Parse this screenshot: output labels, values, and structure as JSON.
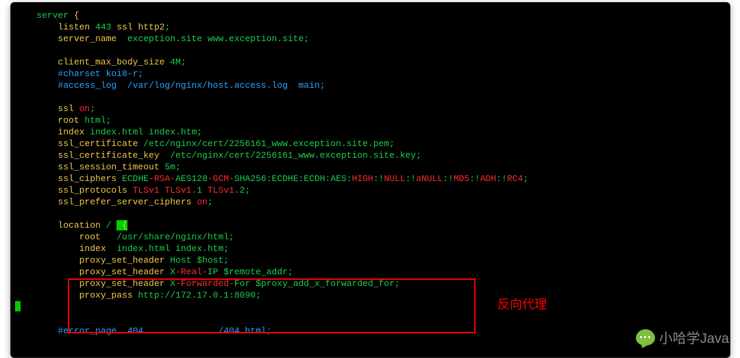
{
  "code": {
    "l1a": "    server ",
    "l1b": "{",
    "l2a": "        listen",
    "l2b": " 443 ",
    "l2c": "ssl http2",
    "l2d": ";",
    "l3a": "        server_name ",
    "l3b": " exception.site www.exception.site;",
    "l5a": "        client_max_body_size",
    "l5b": " 4M;",
    "l6": "        #charset koi8-r;",
    "l7": "        #access_log  /var/log/nginx/host.access.log  main;",
    "l9a": "        ssl ",
    "l9b": "on",
    "l9c": ";",
    "l10a": "        root",
    "l10b": " html;",
    "l11a": "        index",
    "l11b": " index.html index.htm;",
    "l12a": "        ssl_certificate",
    "l12b": " /etc/nginx/cert/2256161_www.exception.site.pem;",
    "l13a": "        ssl_certificate_key ",
    "l13b": " /etc/nginx/cert/2256161_www.exception.site.key;",
    "l14a": "        ssl_session_timeout",
    "l14b": " 5m;",
    "l15a": "        ssl_ciphers",
    "l15b": " ECDHE",
    "l15c": "-RSA-",
    "l15d": "AES128",
    "l15e": "-GCM-",
    "l15f": "SHA256:ECDHE:ECDH:AES:",
    "l15g": "HIGH",
    "l15h": ":!",
    "l15i": "NULL",
    "l15j": ":!",
    "l15k": "aNULL",
    "l15l": ":!",
    "l15m": "MD5",
    "l15n": ":!",
    "l15o": "ADH",
    "l15p": ":!",
    "l15q": "RC4",
    "l15r": ";",
    "l16a": "        ssl_protocols",
    "l16b": " TLSv1 TLSv1",
    "l16c": ".1 ",
    "l16d": "TLSv1",
    "l16e": ".2;",
    "l17a": "        ssl_prefer_server_ciphers ",
    "l17b": "on",
    "l17c": ";",
    "l19a": "        location",
    "l19b": " / ",
    "l19c": " {",
    "l20a": "            root ",
    "l20b": "  /usr/share/nginx/html;",
    "l21a": "            index ",
    "l21b": " index.html index.htm;",
    "l22a": "            proxy_set_header",
    "l22b": " Host $host;",
    "l23a": "            proxy_set_header",
    "l23b": " X",
    "l23c": "-Real-",
    "l23d": "IP $remote_addr;",
    "l24a": "            proxy_set_header",
    "l24b": " X",
    "l24c": "-Forwarded-",
    "l24d": "For $proxy_add_x_forwarded_for;",
    "l25a": "            proxy_pass",
    "l25b": " http://172.17.0.1:8090;",
    "l28a": "        #error_page  404",
    "l28b": "              /404.html;"
  },
  "annotation": "反向代理",
  "watermark": "小哈学Java"
}
